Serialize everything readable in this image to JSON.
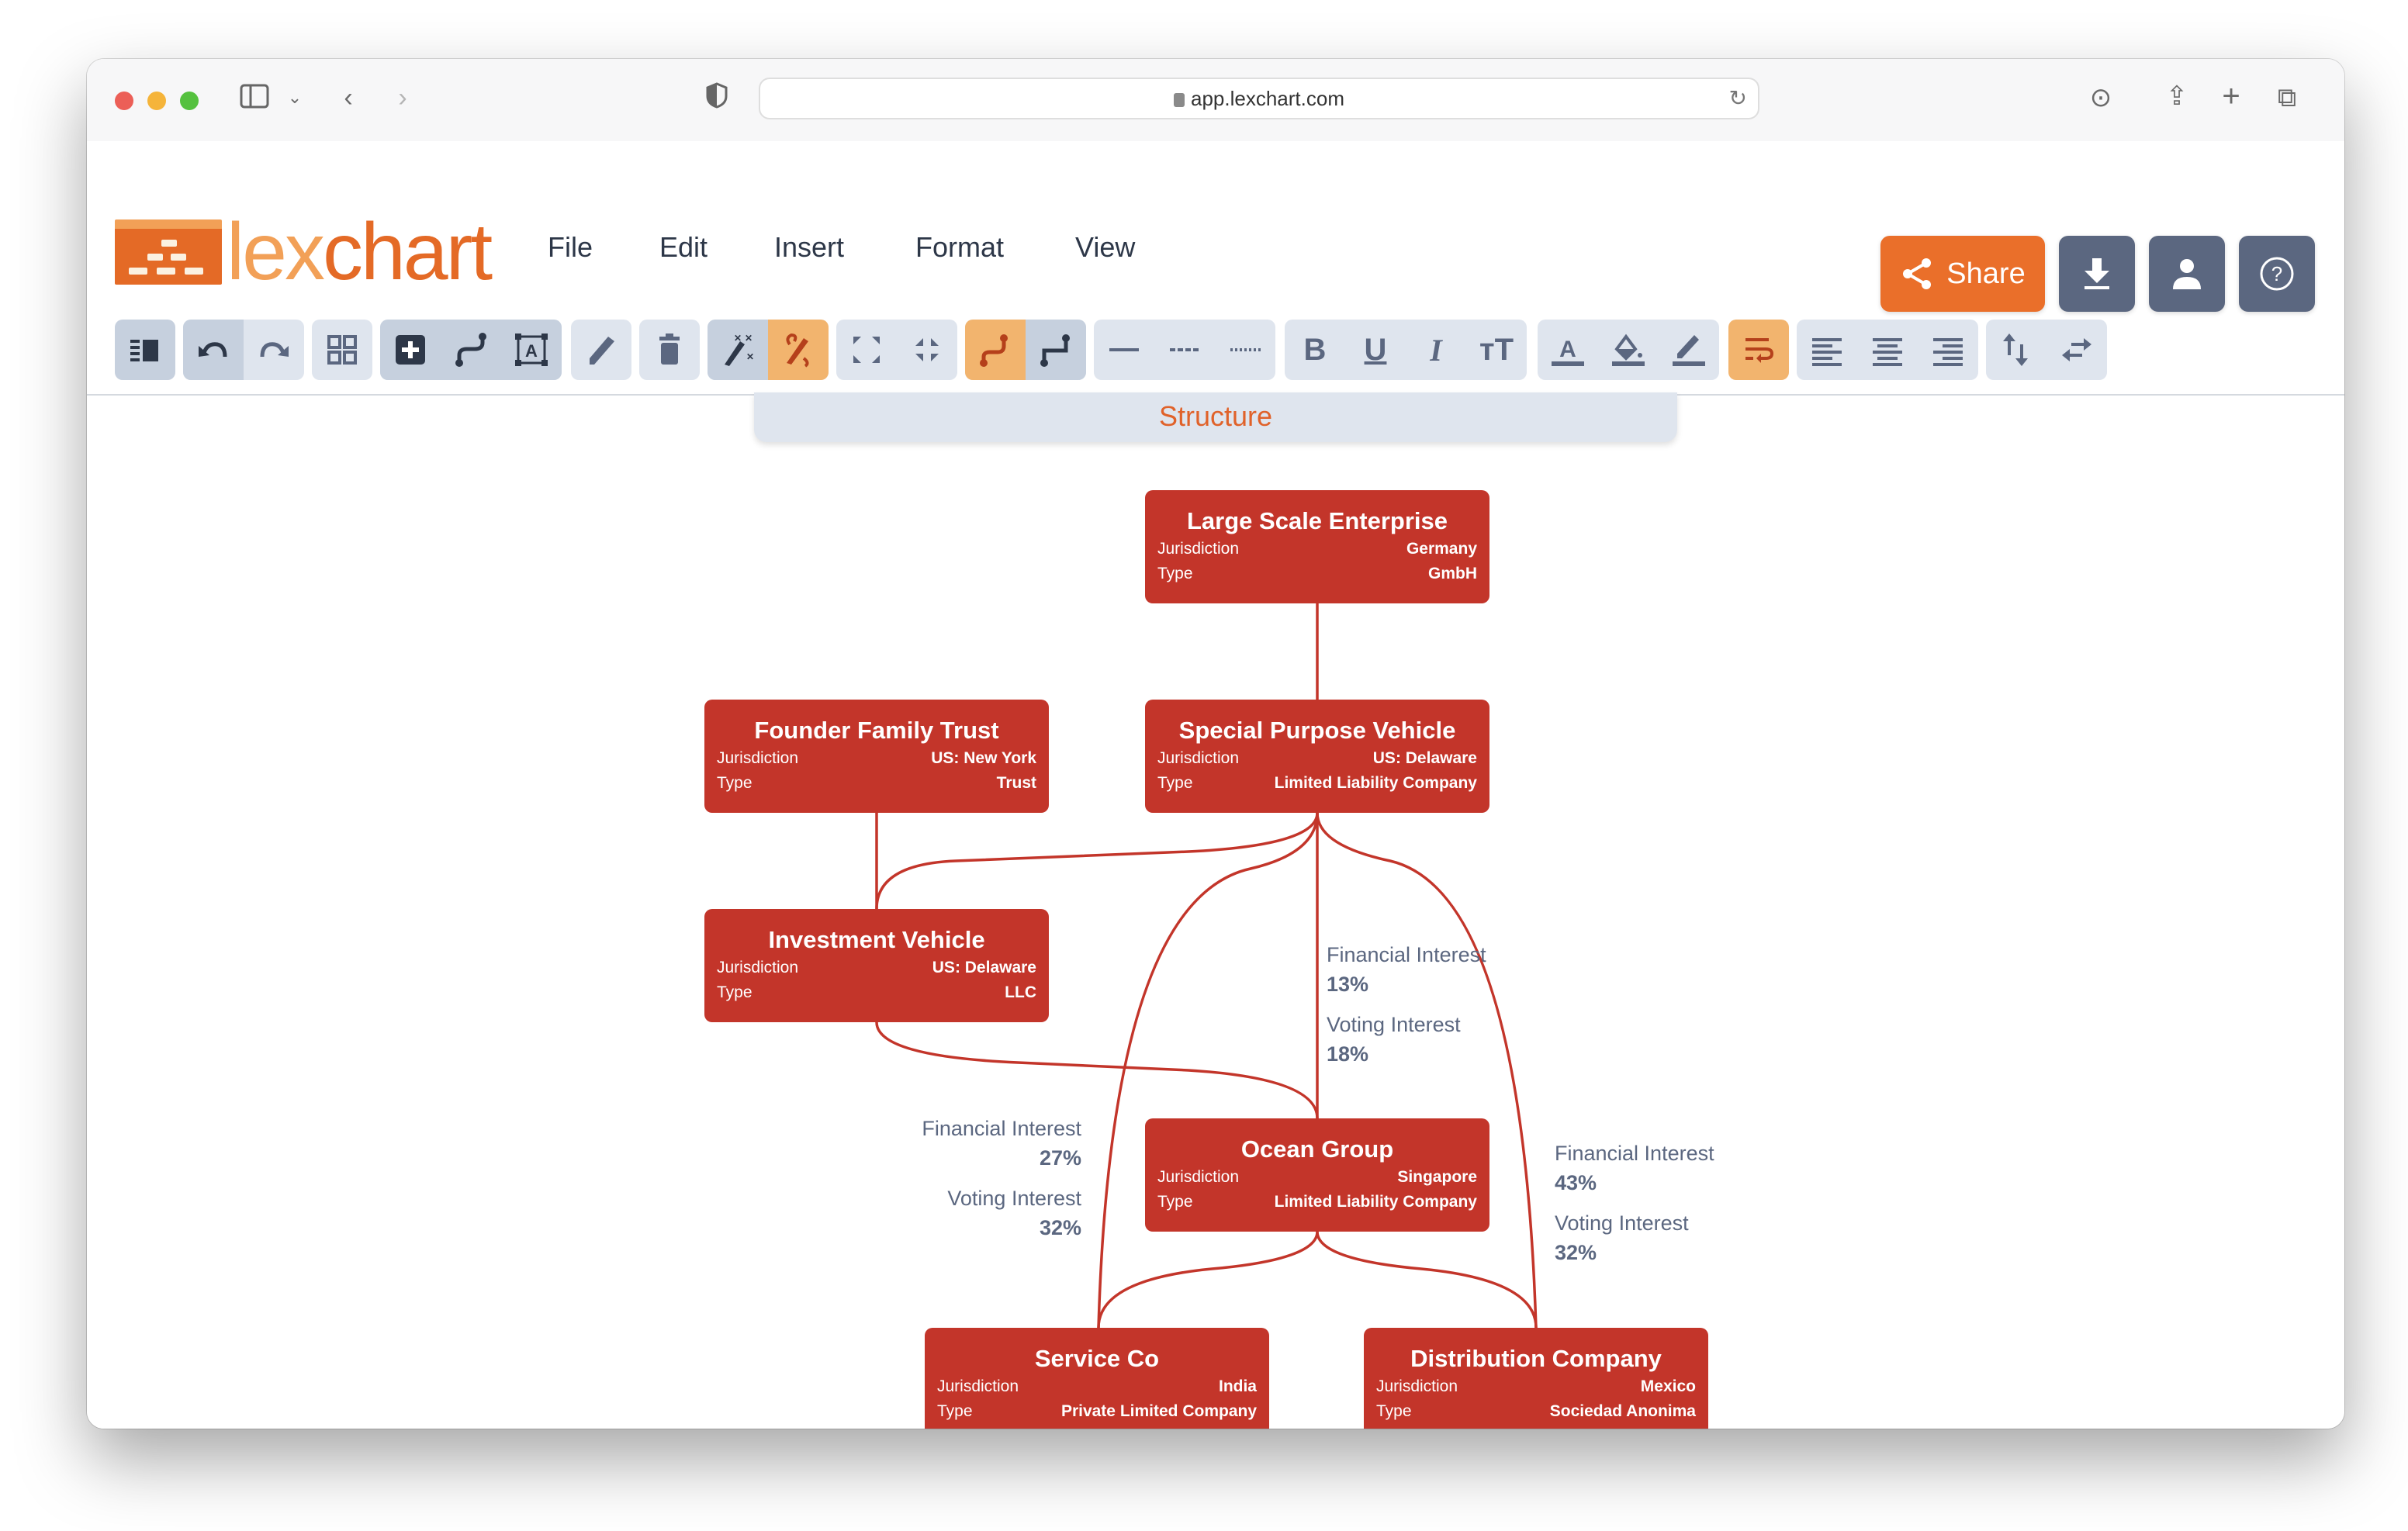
{
  "browser": {
    "url": "app.lexchart.com"
  },
  "app": {
    "logo_part1": "lex",
    "logo_part2": "chart",
    "menu": [
      "File",
      "Edit",
      "Insert",
      "Format",
      "View"
    ],
    "share_label": "Share",
    "colors": {
      "brand_orange": "#ea6f2a",
      "node_red": "#c3352a",
      "slate": "#5b6780",
      "toolbar_bg": "#dfe5ee",
      "active": "#f2b46e"
    }
  },
  "toolbar": {
    "buttons": [
      {
        "icon": "sidebar-toggle-icon"
      },
      {
        "icon": "undo-icon"
      },
      {
        "icon": "redo-icon"
      },
      {
        "icon": "grid-icon"
      },
      {
        "icon": "add-node-icon"
      },
      {
        "icon": "connector-icon"
      },
      {
        "icon": "text-box-icon"
      },
      {
        "icon": "pencil-icon"
      },
      {
        "icon": "trash-icon"
      },
      {
        "icon": "magic-wand-icon"
      },
      {
        "icon": "auto-route-icon"
      },
      {
        "icon": "expand-icon"
      },
      {
        "icon": "collapse-icon"
      },
      {
        "icon": "curved-line-icon"
      },
      {
        "icon": "elbow-line-icon"
      },
      {
        "icon": "solid-line-icon"
      },
      {
        "icon": "dashed-line-icon"
      },
      {
        "icon": "dotted-line-icon"
      },
      {
        "icon": "bold-icon",
        "glyph": "B"
      },
      {
        "icon": "underline-icon",
        "glyph": "U"
      },
      {
        "icon": "italic-icon",
        "glyph": "I"
      },
      {
        "icon": "text-size-icon",
        "glyph": "тТ"
      },
      {
        "icon": "font-color-icon",
        "glyph": "A"
      },
      {
        "icon": "fill-color-icon"
      },
      {
        "icon": "line-color-icon"
      },
      {
        "icon": "text-wrap-icon"
      },
      {
        "icon": "align-left-icon"
      },
      {
        "icon": "align-center-icon"
      },
      {
        "icon": "align-right-icon"
      },
      {
        "icon": "vertical-swap-icon"
      },
      {
        "icon": "horizontal-swap-icon"
      }
    ]
  },
  "diagram": {
    "title": "Structure",
    "field_labels": {
      "jurisdiction": "Jurisdiction",
      "type": "Type"
    },
    "nodes": [
      {
        "name": "Large Scale Enterprise",
        "jurisdiction": "Germany",
        "type": "GmbH"
      },
      {
        "name": "Founder Family Trust",
        "jurisdiction": "US: New York",
        "type": "Trust"
      },
      {
        "name": "Special Purpose Vehicle",
        "jurisdiction": "US: Delaware",
        "type": "Limited Liability Company"
      },
      {
        "name": "Investment Vehicle",
        "jurisdiction": "US: Delaware",
        "type": "LLC"
      },
      {
        "name": "Ocean Group",
        "jurisdiction": "Singapore",
        "type": "Limited Liability Company"
      },
      {
        "name": "Service Co",
        "jurisdiction": "India",
        "type": "Private Limited Company"
      },
      {
        "name": "Distribution Company",
        "jurisdiction": "Mexico",
        "type": "Sociedad Anonima"
      }
    ],
    "edge_labels": [
      {
        "from": "Special Purpose Vehicle",
        "to": "Ocean Group",
        "financial_label": "Financial Interest",
        "financial": "13%",
        "voting_label": "Voting Interest",
        "voting": "18%"
      },
      {
        "from": "Special Purpose Vehicle",
        "to": "Service Co",
        "financial_label": "Financial Interest",
        "financial": "27%",
        "voting_label": "Voting Interest",
        "voting": "32%"
      },
      {
        "from": "Special Purpose Vehicle",
        "to": "Distribution Company",
        "financial_label": "Financial Interest",
        "financial": "43%",
        "voting_label": "Voting Interest",
        "voting": "32%"
      }
    ]
  }
}
